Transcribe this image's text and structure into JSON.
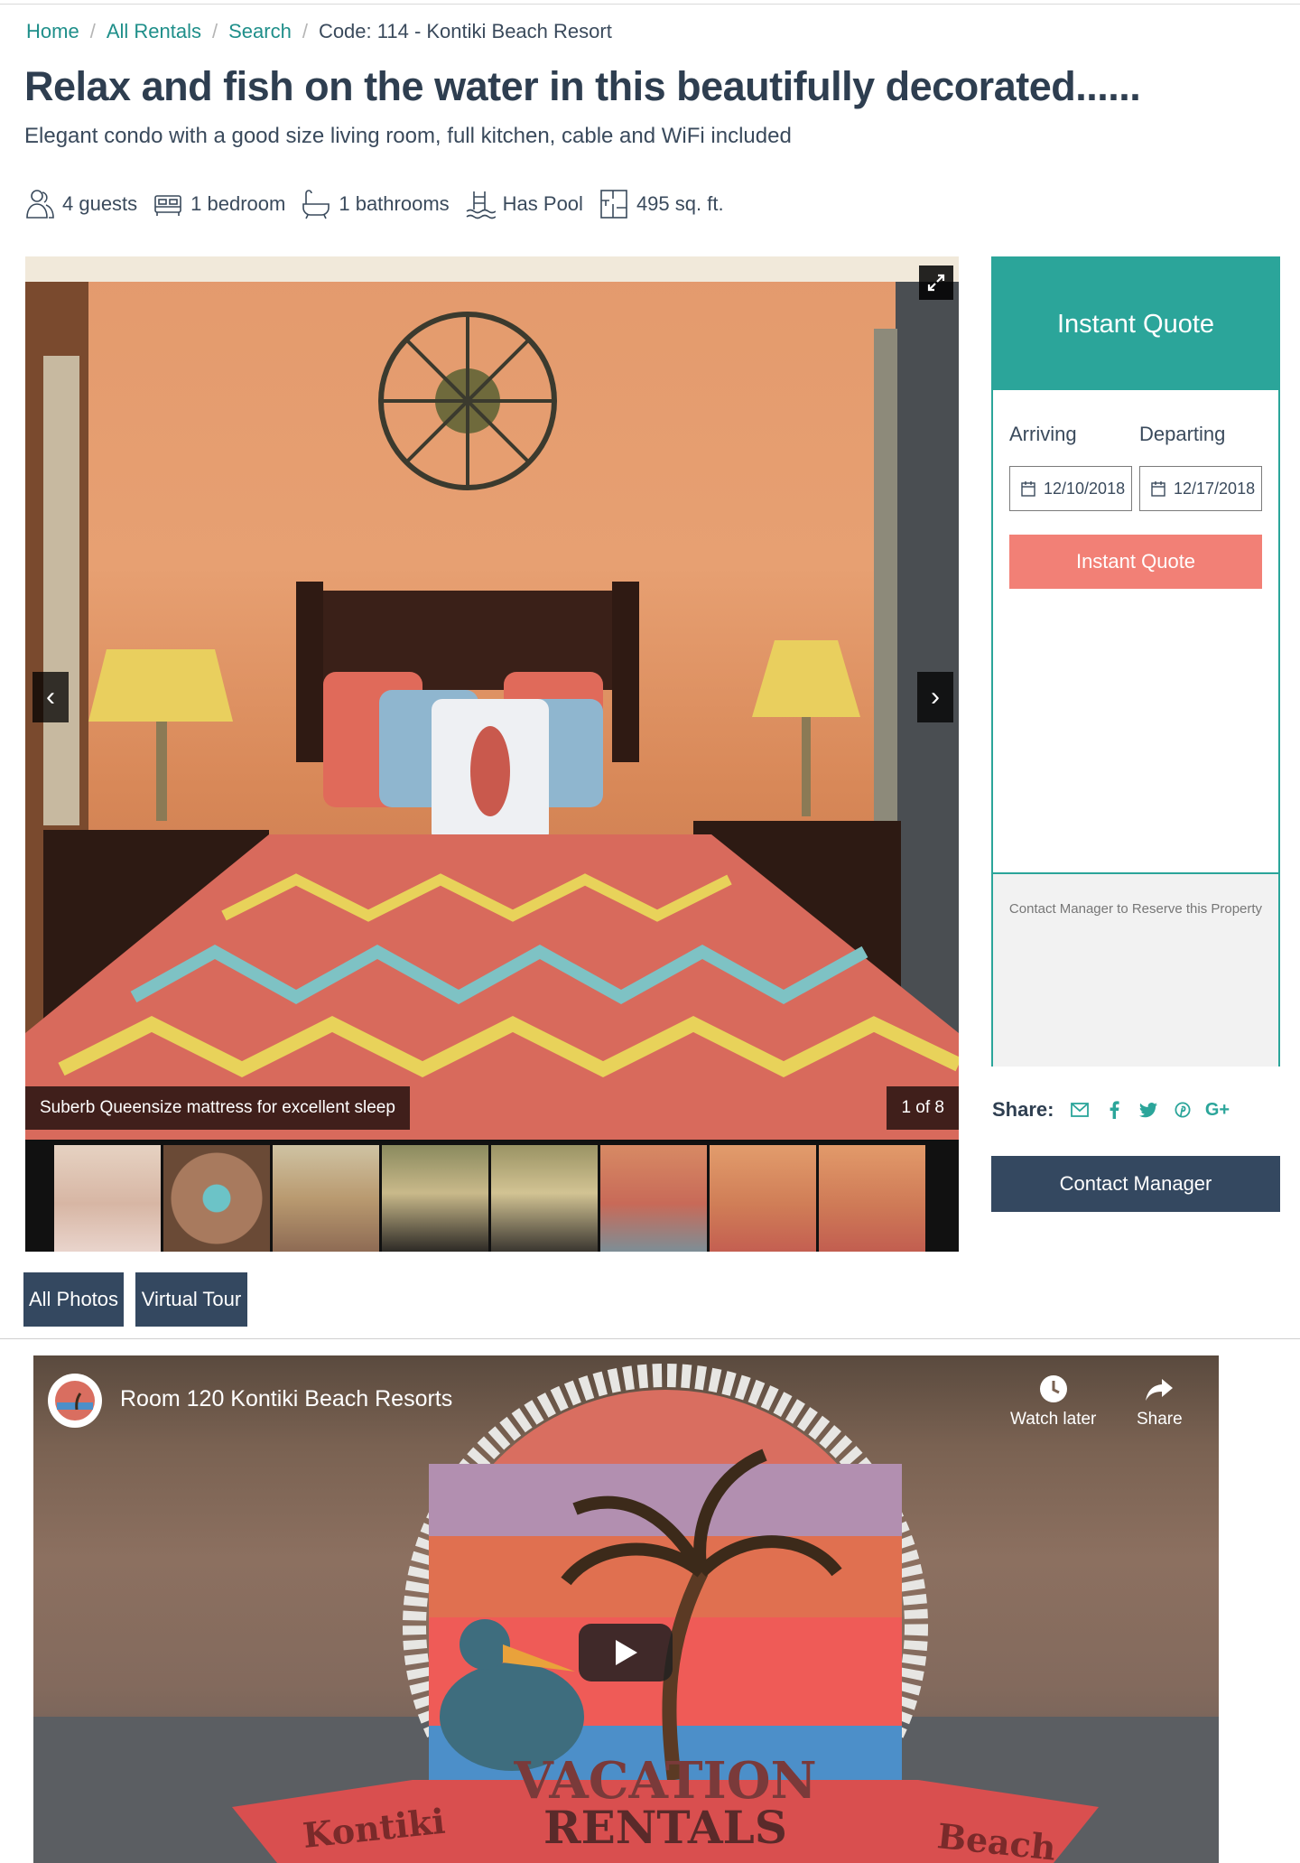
{
  "breadcrumb": {
    "home": "Home",
    "all_rentals": "All Rentals",
    "search": "Search",
    "current": "Code: 114 - Kontiki Beach Resort"
  },
  "listing": {
    "title": "Relax and fish on the water in this beautifully decorated......",
    "subtitle": "Elegant condo with a good size living room, full kitchen, cable and WiFi included"
  },
  "amenities": [
    {
      "icon": "guests-icon",
      "label": "4 guests"
    },
    {
      "icon": "bed-icon",
      "label": "1 bedroom"
    },
    {
      "icon": "bathtub-icon",
      "label": "1 bathrooms"
    },
    {
      "icon": "pool-icon",
      "label": "Has Pool"
    },
    {
      "icon": "floorplan-icon",
      "label": "495 sq. ft."
    }
  ],
  "gallery": {
    "caption": "Suberb Queensize mattress for excellent sleep",
    "counter": "1 of 8",
    "prev_glyph": "‹",
    "next_glyph": "›",
    "thumbnails": 8
  },
  "buttons": {
    "all_photos": "All Photos",
    "virtual_tour": "Virtual Tour"
  },
  "quote": {
    "header": "Instant Quote",
    "arriving_label": "Arriving",
    "departing_label": "Departing",
    "arriving_value": "12/10/2018",
    "departing_value": "12/17/2018",
    "button": "Instant Quote",
    "contact_note": "Contact Manager to Reserve this Property"
  },
  "share": {
    "label": "Share:",
    "icons": [
      "email-icon",
      "facebook-icon",
      "twitter-icon",
      "pinterest-icon",
      "google-plus-icon"
    ]
  },
  "contact_manager": "Contact Manager",
  "video": {
    "title": "Room 120 Kontiki Beach Resorts",
    "watch_later": "Watch later",
    "share": "Share",
    "logo_top": "VACATION",
    "logo_bottom": "RENTALS",
    "banner_left": "Kontiki",
    "banner_right": "Beach"
  },
  "colors": {
    "teal": "#2ba59a",
    "navy": "#344860",
    "coral": "#f28076",
    "link": "#1f8f8a"
  }
}
